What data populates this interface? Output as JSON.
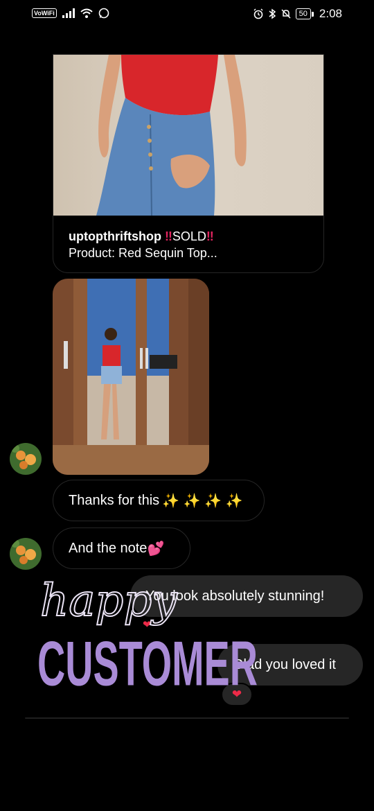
{
  "status_bar": {
    "vowifi": "VoWiFi",
    "battery": "50",
    "time": "2:08"
  },
  "post": {
    "username": "uptopthriftshop",
    "sold_marker_left": "‼",
    "sold_text": "SOLD",
    "sold_marker_right": "‼",
    "product_line": "Product: Red Sequin Top..."
  },
  "messages": {
    "thanks": "Thanks for this",
    "thanks_emoji": "✨ ✨ ✨ ✨",
    "note": "And the note",
    "note_emoji": "💕",
    "reply1": "You look absolutely stunning!",
    "reply2": "Glad you loved it",
    "reaction": "❤"
  },
  "sticker": {
    "script_word": "happy",
    "block_word": "CUSTOMER"
  },
  "colors": {
    "background": "#000000",
    "outgoing_bubble": "#262626",
    "incoming_border": "#262626",
    "heart": "#ed2a48",
    "sticker_purple": "#a98bd6"
  }
}
